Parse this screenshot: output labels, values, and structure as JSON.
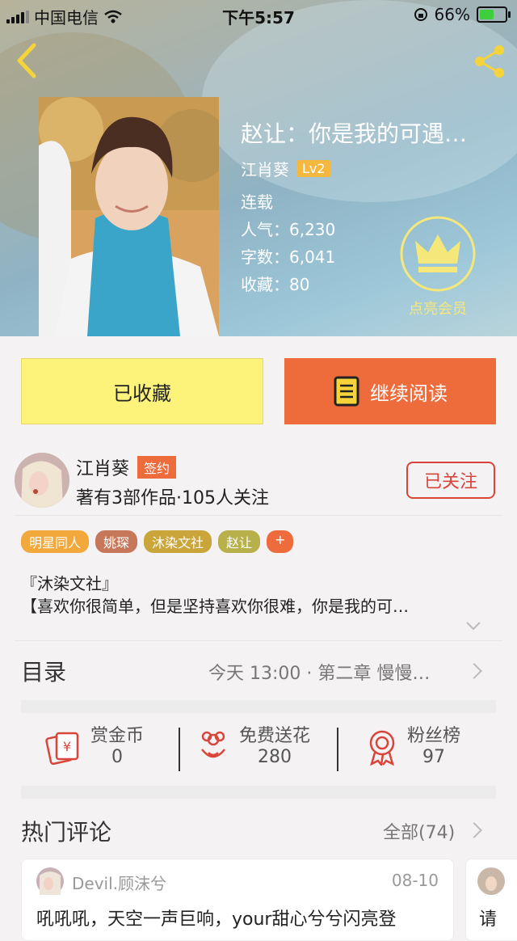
{
  "status_bar": {
    "carrier": "中国电信",
    "time": "下午5:57",
    "battery_percent": "66%",
    "battery_level": 0.66
  },
  "book": {
    "title": "赵让：你是我的可遇…",
    "author": "江肖葵",
    "level": "Lv2",
    "status": "连载",
    "popularity_label": "人气：",
    "popularity": "6,230",
    "words_label": "字数：",
    "words": "6,041",
    "favorites_label": "收藏：",
    "favorites": "80",
    "vip_label": "点亮会员"
  },
  "actions": {
    "favorited_label": "已收藏",
    "continue_label": "继续阅读"
  },
  "author_card": {
    "name": "江肖葵",
    "badge": "签约",
    "info": "著有3部作品·105人关注",
    "follow_label": "已关注"
  },
  "tags": [
    {
      "label": "明星同人",
      "color": "#f2a83a"
    },
    {
      "label": "姚琛",
      "color": "#c8785a"
    },
    {
      "label": "沐染文社",
      "color": "#c9a53a"
    },
    {
      "label": "赵让",
      "color": "#b8b04a"
    },
    {
      "label": "+",
      "color": "#ee6b3c"
    }
  ],
  "description": {
    "line1": "『沐染文社』",
    "line2": "【喜欢你很简单，但是坚持喜欢你很难，你是我的可…"
  },
  "toc": {
    "title": "目录",
    "latest": "今天 13:00 · 第二章 慢慢…"
  },
  "stats": {
    "reward": {
      "label": "赏金币",
      "value": "0"
    },
    "flowers": {
      "label": "免费送花",
      "value": "280"
    },
    "fans": {
      "label": "粉丝榜",
      "value": "97"
    }
  },
  "comments": {
    "title": "热门评论",
    "all_label": "全部(74)",
    "items": [
      {
        "user": "Devil.顾沫兮",
        "date": "08-10",
        "text": "吼吼吼，天空一声巨响，your甜心兮兮闪亮登"
      },
      {
        "text": "请"
      }
    ]
  }
}
